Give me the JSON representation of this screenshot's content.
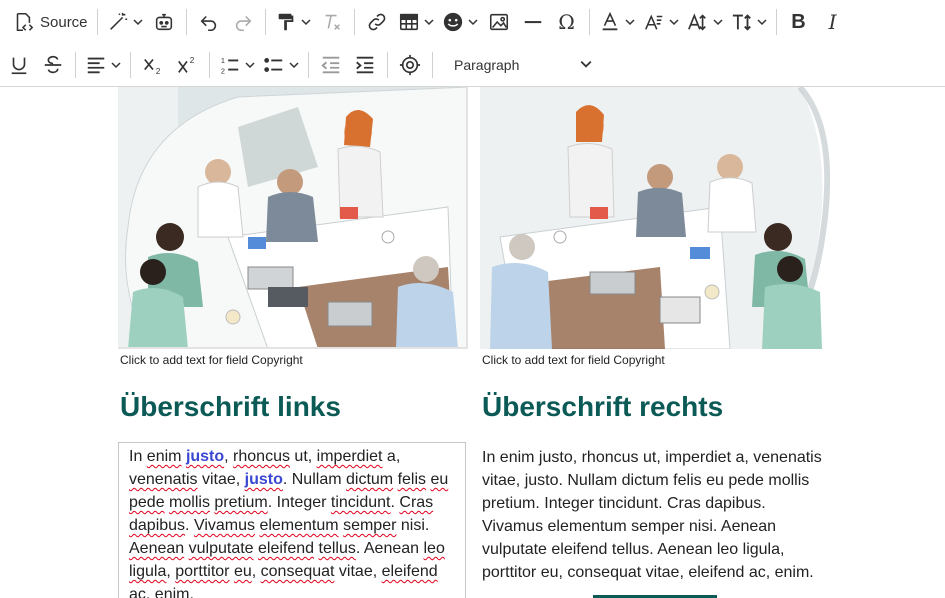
{
  "toolbar": {
    "source_label": "Source",
    "paragraph_select": "Paragraph"
  },
  "images": {
    "left_caption": "Click to add text for field Copyright",
    "right_caption": "Click to add text for field Copyright"
  },
  "left_column": {
    "heading": "Überschrift links",
    "body_parts": [
      "In ",
      "enim",
      " ",
      "justo",
      ", ",
      "rhoncus",
      " ut, ",
      "imperdiet",
      " a, ",
      "venenatis",
      " vitae, ",
      "justo",
      ". Nullam ",
      "dictum",
      " ",
      "felis",
      " ",
      "eu",
      " ",
      "pede",
      " ",
      "mollis",
      " ",
      "pretium",
      ". Integer ",
      "tincidunt",
      ". ",
      "Cras",
      " ",
      "dapibus",
      ". ",
      "Vivamus",
      " ",
      "elementum",
      " ",
      "semper",
      " nisi. ",
      "Aenean",
      " ",
      "vulputate",
      " ",
      "eleifend",
      " ",
      "tellus",
      ". Aenean ",
      "leo",
      " ",
      "ligula",
      ", ",
      "porttitor",
      " ",
      "eu",
      ", ",
      "consequat",
      " vitae, ",
      "eleifend",
      " ac, enim."
    ]
  },
  "right_column": {
    "heading": "Überschrift rechts",
    "body": "In enim justo, rhoncus ut, imperdiet a, venenatis vitae, justo. Nullam dictum felis eu pede mollis pretium. Integer tincidunt. Cras dapibus. Vivamus elementum semper nisi. Aenean vulputate eleifend tellus. Aenean leo ligula, porttitor eu, consequat vitae, eleifend ac, enim."
  },
  "icons": {
    "row1": [
      "source-icon",
      "magic-wand-icon",
      "ai-assistant-icon",
      "undo-icon",
      "redo-icon",
      "paint-format-icon",
      "clear-format-icon",
      "link-icon",
      "table-icon",
      "emoji-icon",
      "image-icon",
      "horizontal-line-icon",
      "special-characters-icon",
      "font-color-icon",
      "font-size-icon",
      "text-case-icon",
      "line-height-icon",
      "bold-icon",
      "italic-icon"
    ],
    "row2": [
      "underline-icon",
      "strikethrough-icon",
      "align-icon",
      "subscript-icon",
      "superscript-icon",
      "numbered-list-icon",
      "bulleted-list-icon",
      "outdent-icon",
      "indent-icon",
      "accessibility-icon",
      "chevron-down-icon"
    ]
  },
  "colors": {
    "heading": "#0b5a56",
    "link": "#3a47d1",
    "spellcheck": "#e0001b",
    "toolbar_border": "#d6d6d6"
  }
}
